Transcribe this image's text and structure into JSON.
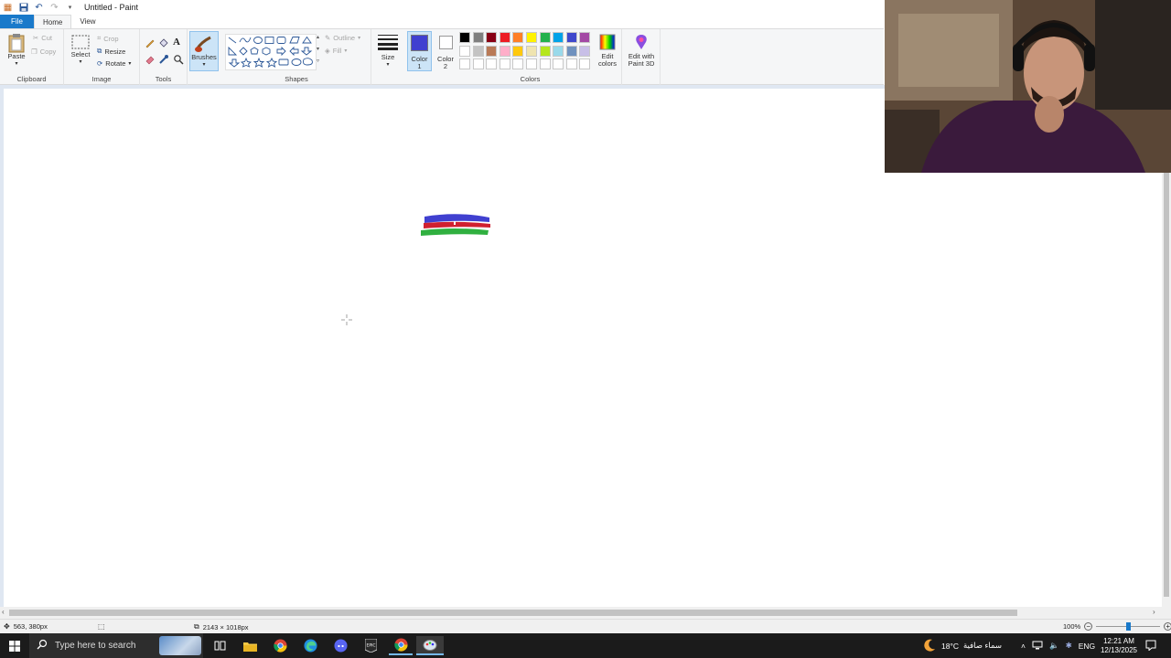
{
  "window": {
    "title": "Untitled - Paint"
  },
  "tabs": [
    {
      "label": "File"
    },
    {
      "label": "Home"
    },
    {
      "label": "View"
    }
  ],
  "ribbon": {
    "clipboard": {
      "paste": "Paste",
      "cut": "Cut",
      "copy": "Copy",
      "group_label": "Clipboard"
    },
    "image": {
      "select": "Select",
      "crop": "Crop",
      "resize": "Resize",
      "rotate": "Rotate",
      "group_label": "Image"
    },
    "tools": {
      "group_label": "Tools"
    },
    "brushes": {
      "label": "Brushes"
    },
    "shapes": {
      "outline": "Outline",
      "fill": "Fill",
      "group_label": "Shapes"
    },
    "size": {
      "label": "Size"
    },
    "color1": {
      "label_line1": "Color",
      "label_line2": "1",
      "color": "#4040d0"
    },
    "color2": {
      "label_line1": "Color",
      "label_line2": "2",
      "color": "#ffffff"
    },
    "colors": {
      "group_label": "Colors",
      "row1": [
        "#000000",
        "#7f7f7f",
        "#880015",
        "#ed1c24",
        "#ff7f27",
        "#fff200",
        "#22b14c",
        "#00a2e8",
        "#3f48cc",
        "#a349a4"
      ],
      "row2": [
        "#ffffff",
        "#c3c3c3",
        "#b97a57",
        "#ffaec9",
        "#ffc90e",
        "#efe4b0",
        "#b5e61d",
        "#99d9ea",
        "#7092be",
        "#c8bfe7"
      ],
      "row3": [
        "#ffffff",
        "#ffffff",
        "#ffffff",
        "#ffffff",
        "#ffffff",
        "#ffffff",
        "#ffffff",
        "#ffffff",
        "#ffffff",
        "#ffffff"
      ]
    },
    "edit_colors": {
      "line1": "Edit",
      "line2": "colors"
    },
    "paint3d": {
      "line1": "Edit with",
      "line2": "Paint 3D"
    }
  },
  "status": {
    "cursor_pos": "563, 380px",
    "canvas_size": "2143 × 1018px",
    "zoom": "100%",
    "zoom_level": 0.5
  },
  "taskbar": {
    "search_placeholder": "Type here to search",
    "weather_temp": "18°C",
    "weather_desc": "سماء صافية",
    "language": "ENG",
    "time": "12:21 AM",
    "date": "12/13/2025"
  }
}
